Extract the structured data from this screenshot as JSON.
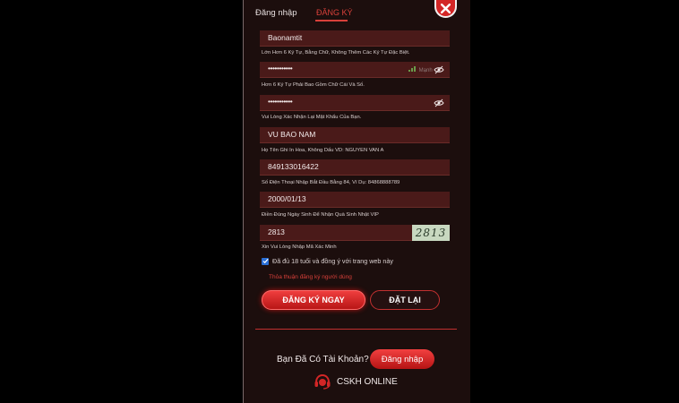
{
  "tabs": {
    "login": "Đăng nhập",
    "register": "ĐĂNG KÝ"
  },
  "close_icon": "close-icon",
  "fields": {
    "username": {
      "value": "Baonamtit",
      "hint": "Lớn Hơn 6 Ký Tự, Bằng Chữ, Không Thêm Các Ký Tự Đặc Biệt."
    },
    "password": {
      "value": "•••••••••••",
      "strength": "Mạnh",
      "hint": "Hơn 6 Ký Tự Phải Bao Gồm Chữ Cái Và Số."
    },
    "confirm_password": {
      "value": "•••••••••••",
      "hint": "Vui Lòng Xác Nhận Lại Mật Khẩu Của Bạn."
    },
    "full_name": {
      "value": "VU BAO NAM",
      "hint": "Họ Tên Ghi In Hoa, Không Dấu VD: NGUYEN VAN A"
    },
    "phone": {
      "value": "849133016422",
      "hint": "Số Điện Thoại Nhập Bắt Đầu Bằng 84, Ví Dụ: 84868888789"
    },
    "birthday": {
      "value": "2000/01/13",
      "hint": "Điền Đúng Ngày Sinh Để Nhận Quà Sinh Nhật VIP"
    },
    "captcha": {
      "value": "2813",
      "image_text": "2813",
      "hint": "Xin Vui Lòng Nhập Mã Xác Minh"
    }
  },
  "agree": {
    "checked": true,
    "label": "Đã đủ 18 tuổi và đồng ý với trang web này"
  },
  "terms_link": "Thỏa thuận đăng ký người dùng",
  "buttons": {
    "register_now": "ĐĂNG KÝ NGAY",
    "reset": "ĐẶT LẠI",
    "login": "Đăng nhập"
  },
  "have_account": "Bạn Đã Có Tài Khoản?",
  "support": {
    "label": "CSKH ONLINE",
    "icon": "headset-icon"
  },
  "colors": {
    "accent": "#d8403a",
    "panel_bg": "#1c0e0d",
    "field_bg": "#4a1a19",
    "button_red": "#d32626"
  }
}
